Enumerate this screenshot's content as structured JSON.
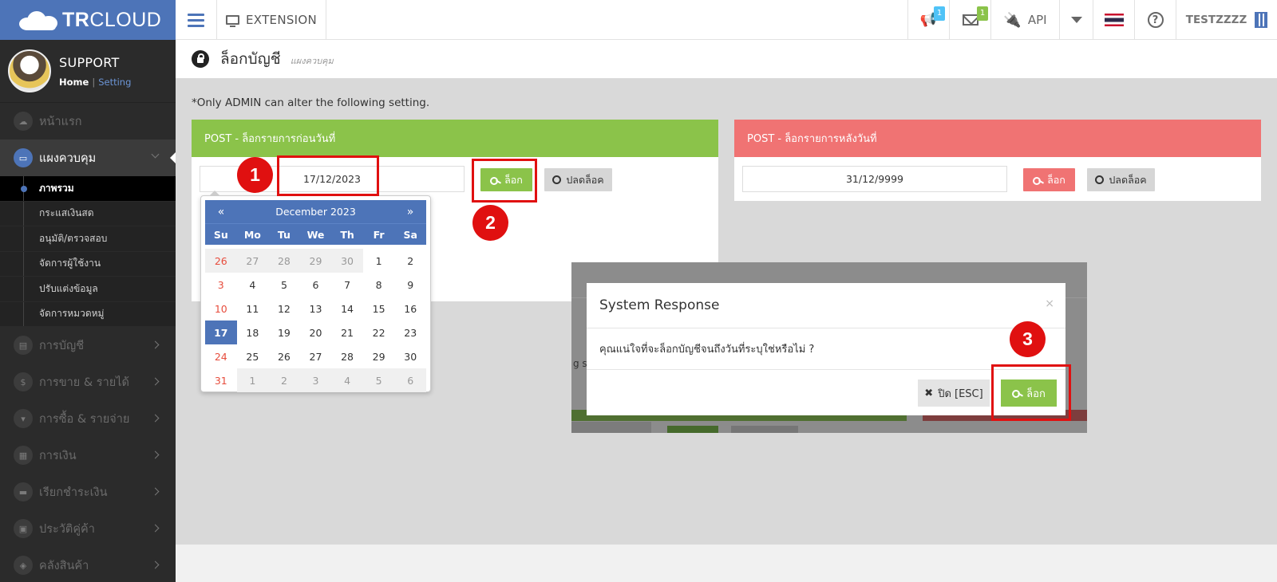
{
  "brand": {
    "bold": "TR",
    "light": "CLOUD"
  },
  "topbar": {
    "extension": "EXTENSION",
    "notif_count": "1",
    "mail_count": "1",
    "api": "API",
    "user": "TESTZZZZ",
    "colors": {
      "brand": "#4d74b8",
      "badge_blue": "#4fc3f7",
      "badge_green": "#8bc34a"
    }
  },
  "profile": {
    "name": "SUPPORT",
    "home": "Home",
    "separator": "|",
    "setting": "Setting"
  },
  "sidebar": {
    "items": [
      {
        "label": "หน้าแรก",
        "icon": "cloud-icon"
      },
      {
        "label": "แผงควบคุม",
        "icon": "monitor-icon",
        "active": true
      },
      {
        "label": "การบัญชี",
        "icon": "book-icon"
      },
      {
        "label": "การขาย & รายได้",
        "icon": "dollar-icon"
      },
      {
        "label": "การซื้อ & รายจ่าย",
        "icon": "cart-icon"
      },
      {
        "label": "การเงิน",
        "icon": "calendar-icon"
      },
      {
        "label": "เรียกชำระเงิน",
        "icon": "card-icon"
      },
      {
        "label": "ประวัติคู่ค้า",
        "icon": "contact-icon"
      },
      {
        "label": "คลังสินค้า",
        "icon": "box-icon"
      }
    ],
    "sub_items": [
      "ภาพรวม",
      "กระแสเงินสด",
      "อนุมัติ/ตรวจสอบ",
      "จัดการผู้ใช้งาน",
      "ปรับแต่งข้อมูล",
      "จัดการหมวดหมู่"
    ]
  },
  "page": {
    "title": "ล็อกบัญชี",
    "subtitle": "แผงควบคุม",
    "note": "*Only ADMIN can alter the following setting."
  },
  "post_before": {
    "header": "POST - ล็อกรายการก่อนวันที่",
    "date": "17/12/2023",
    "lock_label": "ล็อก",
    "unlock_label": "ปลดล็อค",
    "color": "#8bc34a"
  },
  "post_after": {
    "header": "POST - ล็อกรายการหลังวันที่",
    "date": "31/12/9999",
    "lock_label": "ล็อก",
    "unlock_label": "ปลดล็อค",
    "color": "#f07373"
  },
  "datepicker": {
    "prev": "«",
    "next": "»",
    "month": "December 2023",
    "dows": [
      "Su",
      "Mo",
      "Tu",
      "We",
      "Th",
      "Fr",
      "Sa"
    ],
    "days": [
      "26",
      "27",
      "28",
      "29",
      "30",
      "1",
      "2",
      "3",
      "4",
      "5",
      "6",
      "7",
      "8",
      "9",
      "10",
      "11",
      "12",
      "13",
      "14",
      "15",
      "16",
      "17",
      "18",
      "19",
      "20",
      "21",
      "22",
      "23",
      "24",
      "25",
      "26",
      "27",
      "28",
      "29",
      "30",
      "31",
      "1",
      "2",
      "3",
      "4",
      "5",
      "6"
    ],
    "old_days_indices": [
      0,
      1,
      2,
      3,
      4,
      36,
      37,
      38,
      39,
      40,
      41
    ],
    "selected_index": 21
  },
  "modal": {
    "title": "System Response",
    "close_x": "×",
    "message": "คุณแน่ใจที่จะล็อกบัญชีจนถึงวันที่ระบุใช่หรือไม่ ?",
    "close_label": "ปิด [ESC]",
    "lock_label": "ล็อก"
  },
  "annotations": {
    "step1": "1",
    "step2": "2",
    "step3": "3"
  },
  "hidden_fragment": "g s"
}
